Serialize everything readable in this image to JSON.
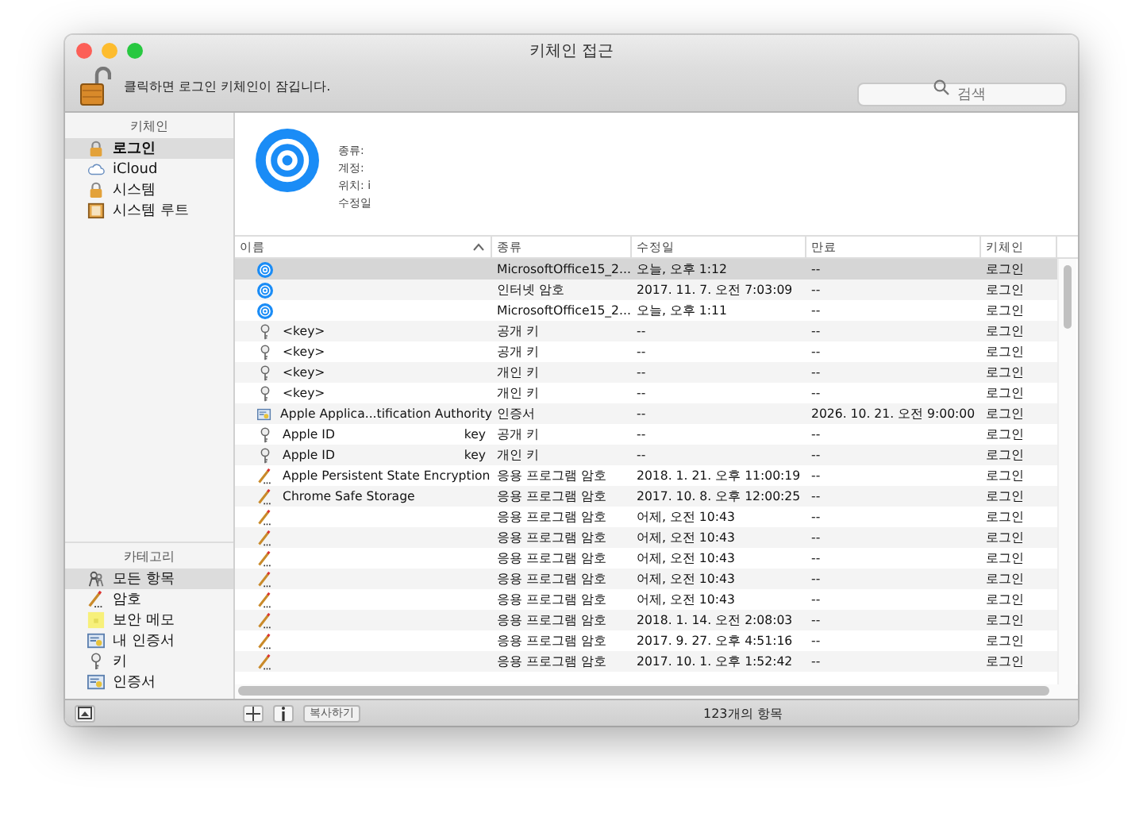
{
  "window": {
    "title": "키체인 접근"
  },
  "toolbar": {
    "lock_message": "클릭하면 로그인 키체인이 잠깁니다.",
    "search": {
      "placeholder": "검색"
    }
  },
  "sidebar": {
    "keychains_heading": "키체인",
    "keychains": [
      {
        "label": "로그인",
        "kind": "login",
        "selected": true
      },
      {
        "label": "iCloud",
        "kind": "cloud",
        "selected": false
      },
      {
        "label": "시스템",
        "kind": "lock",
        "selected": false
      },
      {
        "label": "시스템 루트",
        "kind": "cabinet",
        "selected": false
      }
    ],
    "category_heading": "카테고리",
    "categories": [
      {
        "label": "모든 항목",
        "kind": "people",
        "selected": true
      },
      {
        "label": "암호",
        "kind": "pencil",
        "selected": false
      },
      {
        "label": "보안 메모",
        "kind": "note",
        "selected": false
      },
      {
        "label": "내 인증서",
        "kind": "mycert",
        "selected": false
      },
      {
        "label": "키",
        "kind": "key",
        "selected": false
      },
      {
        "label": "인증서",
        "kind": "cert",
        "selected": false
      }
    ]
  },
  "detail": {
    "labels": [
      "종류:",
      "계정:",
      "위치: i",
      "수정일"
    ]
  },
  "table": {
    "columns": [
      "이름",
      "종류",
      "수정일",
      "만료",
      "키체인"
    ],
    "rows": [
      {
        "kind": "at",
        "name": "",
        "type": "MicrosoftOffice15_2...",
        "modified": "오늘, 오후 1:12",
        "expires": "--",
        "keychain": "로그인",
        "selected": true
      },
      {
        "kind": "at",
        "name": "",
        "type": "인터넷 암호",
        "modified": "2017. 11. 7. 오전 7:03:09",
        "expires": "--",
        "keychain": "로그인",
        "selected": false
      },
      {
        "kind": "at",
        "name": "",
        "type": "MicrosoftOffice15_2...",
        "modified": "오늘, 오후 1:11",
        "expires": "--",
        "keychain": "로그인",
        "selected": false
      },
      {
        "kind": "key",
        "name": "<key>",
        "type": "공개 키",
        "modified": "--",
        "expires": "--",
        "keychain": "로그인",
        "selected": false
      },
      {
        "kind": "key",
        "name": "<key>",
        "type": "공개 키",
        "modified": "--",
        "expires": "--",
        "keychain": "로그인",
        "selected": false
      },
      {
        "kind": "key",
        "name": "<key>",
        "type": "개인 키",
        "modified": "--",
        "expires": "--",
        "keychain": "로그인",
        "selected": false
      },
      {
        "kind": "key",
        "name": "<key>",
        "type": "개인 키",
        "modified": "--",
        "expires": "--",
        "keychain": "로그인",
        "selected": false
      },
      {
        "kind": "cert",
        "name": "Apple Applica...tification Authority",
        "type": "인증서",
        "modified": "--",
        "expires": "2026. 10. 21. 오전 9:00:00",
        "keychain": "로그인",
        "selected": false
      },
      {
        "kind": "key",
        "name": "Apple ID",
        "name_suffix": "key",
        "type": "공개 키",
        "modified": "--",
        "expires": "--",
        "keychain": "로그인",
        "selected": false
      },
      {
        "kind": "key",
        "name": "Apple ID",
        "name_suffix": "key",
        "type": "개인 키",
        "modified": "--",
        "expires": "--",
        "keychain": "로그인",
        "selected": false
      },
      {
        "kind": "pencil",
        "name": "Apple Persistent State Encryption",
        "type": "응용 프로그램 암호",
        "modified": "2018. 1. 21. 오후 11:00:19",
        "expires": "--",
        "keychain": "로그인",
        "selected": false
      },
      {
        "kind": "pencil",
        "name": "Chrome Safe Storage",
        "type": "응용 프로그램 암호",
        "modified": "2017. 10. 8. 오후 12:00:25",
        "expires": "--",
        "keychain": "로그인",
        "selected": false
      },
      {
        "kind": "pencil",
        "name": "",
        "type": "응용 프로그램 암호",
        "modified": "어제, 오전 10:43",
        "expires": "--",
        "keychain": "로그인",
        "selected": false
      },
      {
        "kind": "pencil",
        "name": "",
        "type": "응용 프로그램 암호",
        "modified": "어제, 오전 10:43",
        "expires": "--",
        "keychain": "로그인",
        "selected": false
      },
      {
        "kind": "pencil",
        "name": "",
        "type": "응용 프로그램 암호",
        "modified": "어제, 오전 10:43",
        "expires": "--",
        "keychain": "로그인",
        "selected": false
      },
      {
        "kind": "pencil",
        "name": "",
        "type": "응용 프로그램 암호",
        "modified": "어제, 오전 10:43",
        "expires": "--",
        "keychain": "로그인",
        "selected": false
      },
      {
        "kind": "pencil",
        "name": "",
        "type": "응용 프로그램 암호",
        "modified": "어제, 오전 10:43",
        "expires": "--",
        "keychain": "로그인",
        "selected": false
      },
      {
        "kind": "pencil",
        "name": "",
        "type": "응용 프로그램 암호",
        "modified": "2018. 1. 14. 오전 2:08:03",
        "expires": "--",
        "keychain": "로그인",
        "selected": false
      },
      {
        "kind": "pencil",
        "name": "",
        "type": "응용 프로그램 암호",
        "modified": "2017. 9. 27. 오후 4:51:16",
        "expires": "--",
        "keychain": "로그인",
        "selected": false
      },
      {
        "kind": "pencil",
        "name": "",
        "type": "응용 프로그램 암호",
        "modified": "2017. 10. 1. 오후 1:52:42",
        "expires": "--",
        "keychain": "로그인",
        "selected": false
      }
    ]
  },
  "bottom_bar": {
    "copy_button": "복사하기",
    "item_count": "123개의 항목"
  }
}
